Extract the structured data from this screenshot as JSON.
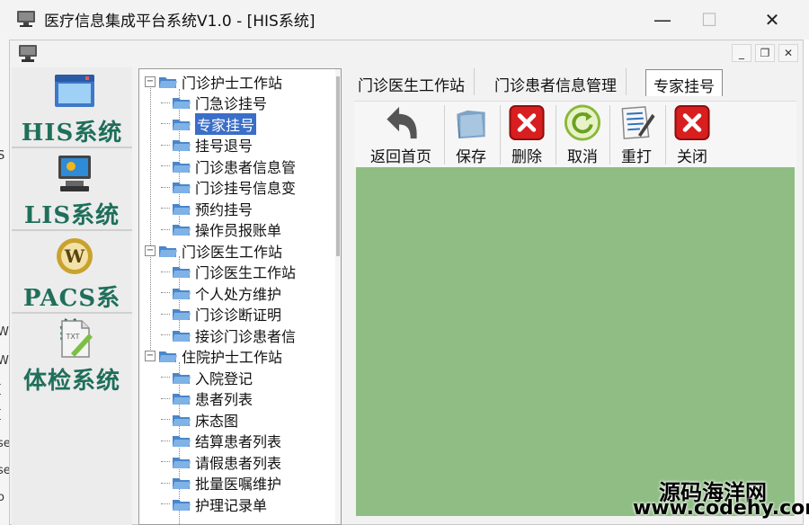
{
  "window": {
    "title": "医疗信息集成平台系统V1.0 - [HIS系统]",
    "minimize_glyph": "—",
    "maximize_glyph": "☐",
    "close_glyph": "✕"
  },
  "mdi": {
    "minimize_glyph": "_",
    "restore_glyph": "❐",
    "close_glyph": "✕"
  },
  "background_app_fragments": [
    "S",
    "W",
    "W",
    "[",
    "[",
    "se",
    "se",
    "o"
  ],
  "systems": [
    {
      "label": "HIS系统",
      "icon": "window-icon"
    },
    {
      "label": "LIS系统",
      "icon": "computer-icon"
    },
    {
      "label": "PACS系统",
      "icon": "wordpress-globe-icon"
    },
    {
      "label": "体检系统",
      "icon": "txt-document-icon"
    }
  ],
  "tree": {
    "groups": [
      {
        "label": "门诊护士工作站",
        "expander": "−",
        "items": [
          "门急诊挂号",
          "专家挂号",
          "挂号退号",
          "门诊患者信息管",
          "门诊挂号信息变",
          "预约挂号",
          "操作员报账单"
        ]
      },
      {
        "label": "门诊医生工作站",
        "expander": "−",
        "items": [
          "门诊医生工作站",
          "个人处方维护",
          "门诊诊断证明",
          "接诊门诊患者信"
        ]
      },
      {
        "label": "住院护士工作站",
        "expander": "−",
        "items": [
          "入院登记",
          "患者列表",
          "床态图",
          "结算患者列表",
          "请假患者列表",
          "批量医嘱维护",
          "护理记录单"
        ]
      }
    ],
    "selected": "专家挂号"
  },
  "tabs": [
    "门诊医生工作站",
    "门诊患者信息管理",
    "专家挂号"
  ],
  "active_tab": "专家挂号",
  "toolbar": {
    "home_label": "返回首页",
    "save_label": "保存",
    "delete_label": "删除",
    "cancel_label": "取消",
    "print_label": "重打",
    "close_label": "关闭"
  },
  "colors": {
    "content_bg": "#8fbd84",
    "system_label": "#1f6f5a",
    "tree_selection": "#3a6ec8",
    "delete_red": "#d81e1e"
  },
  "watermark": {
    "line1": "源码海洋网",
    "line2": "www.codehy.com"
  }
}
